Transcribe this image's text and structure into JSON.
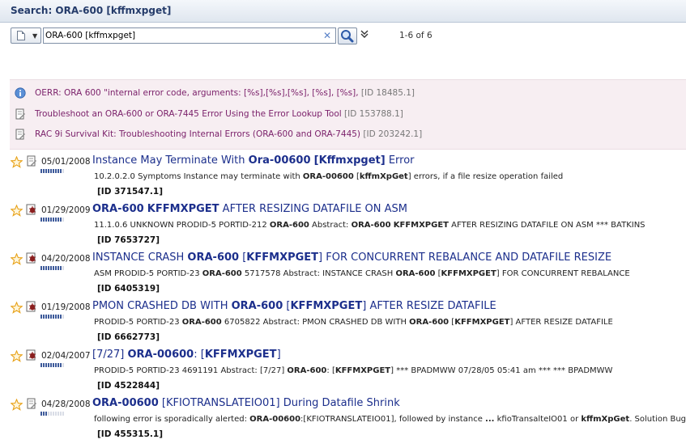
{
  "header": {
    "title": "Search: ORA-600 [kffmxpget]"
  },
  "search": {
    "query": "ORA-600 [kffmxpget]",
    "count": "1-6 of 6"
  },
  "colors": {
    "title": "#1c2f8c",
    "featured_link": "#7a1f69",
    "featured_bg": "#f7eef2",
    "star": "#e8a21a"
  },
  "featured": [
    {
      "icon": "info-icon",
      "text": "OERR:  ORA 600   \"internal error code, arguments: [%s],[%s],[%s], [%s], [%s],",
      "id": "[ID 18485.1]"
    },
    {
      "icon": "document-icon",
      "text": "Troubleshoot an ORA-600 or ORA-7445 Error Using the Error Lookup Tool",
      "id": "[ID 153788.1]"
    },
    {
      "icon": "document-icon",
      "text": "RAC 9i Survival Kit: Troubleshooting Internal Errors (ORA-600 and ORA-7445)",
      "id": "[ID 203242.1]"
    }
  ],
  "results": [
    {
      "type_icon": "note-icon",
      "date": "05/01/2008",
      "relevance": 9,
      "title": [
        {
          "t": "Instance May Terminate With "
        },
        {
          "t": "Ora-00600",
          "b": true
        },
        {
          "t": " "
        },
        {
          "t": "[Kffmxpget]",
          "b": true
        },
        {
          "t": " Error"
        }
      ],
      "snippet": [
        {
          "t": "10.2.0.2.0 Symptoms Instance may terminate with "
        },
        {
          "t": "ORA-00600",
          "b": true
        },
        {
          "t": " ["
        },
        {
          "t": "kffmXpGet",
          "b": true
        },
        {
          "t": "] errors, if a file resize operation failed"
        }
      ],
      "id": "[ID 371547.1]"
    },
    {
      "type_icon": "bug-icon",
      "date": "01/29/2009",
      "relevance": 9,
      "title": [
        {
          "t": "ORA-600",
          "b": true
        },
        {
          "t": " "
        },
        {
          "t": "KFFMXPGET",
          "b": true
        },
        {
          "t": " AFTER RESIZING DATAFILE ON ASM"
        }
      ],
      "snippet": [
        {
          "t": "11.1.0.6 UNKNOWN PRODID-5 PORTID-212 "
        },
        {
          "t": "ORA-600",
          "b": true
        },
        {
          "t": " Abstract: "
        },
        {
          "t": "ORA-600",
          "b": true
        },
        {
          "t": " "
        },
        {
          "t": "KFFMXPGET",
          "b": true
        },
        {
          "t": " AFTER RESIZING DATAFILE ON ASM *** BATKINS"
        }
      ],
      "id": "[ID 7653727]"
    },
    {
      "type_icon": "bug-icon",
      "date": "04/20/2008",
      "relevance": 9,
      "title": [
        {
          "t": "INSTANCE CRASH "
        },
        {
          "t": "ORA-600",
          "b": true
        },
        {
          "t": " ["
        },
        {
          "t": "KFFMXPGET",
          "b": true
        },
        {
          "t": "] FOR CONCURRENT REBALANCE AND DATAFILE RESIZE"
        }
      ],
      "snippet": [
        {
          "t": "ASM PRODID-5 PORTID-23 "
        },
        {
          "t": "ORA-600",
          "b": true
        },
        {
          "t": " 5717578 Abstract: INSTANCE CRASH "
        },
        {
          "t": "ORA-600",
          "b": true
        },
        {
          "t": " ["
        },
        {
          "t": "KFFMXPGET",
          "b": true
        },
        {
          "t": "] FOR CONCURRENT REBALANCE"
        }
      ],
      "id": "[ID 6405319]"
    },
    {
      "type_icon": "bug-icon",
      "date": "01/19/2008",
      "relevance": 9,
      "title": [
        {
          "t": "PMON CRASHED DB WITH "
        },
        {
          "t": "ORA-600",
          "b": true
        },
        {
          "t": " ["
        },
        {
          "t": "KFFMXPGET",
          "b": true
        },
        {
          "t": "] AFTER RESIZE DATAFILE"
        }
      ],
      "snippet": [
        {
          "t": "PRODID-5 PORTID-23 "
        },
        {
          "t": "ORA-600",
          "b": true
        },
        {
          "t": " 6705822 Abstract: PMON CRASHED DB WITH "
        },
        {
          "t": "ORA-600",
          "b": true
        },
        {
          "t": " ["
        },
        {
          "t": "KFFMXPGET",
          "b": true
        },
        {
          "t": "] AFTER RESIZE DATAFILE"
        }
      ],
      "id": "[ID 6662773]"
    },
    {
      "type_icon": "bug-icon",
      "date": "02/04/2007",
      "relevance": 9,
      "title": [
        {
          "t": "[7/27] "
        },
        {
          "t": "ORA-00600",
          "b": true
        },
        {
          "t": ":  ["
        },
        {
          "t": "KFFMXPGET",
          "b": true
        },
        {
          "t": "]"
        }
      ],
      "snippet": [
        {
          "t": "PRODID-5 PORTID-23 4691191 Abstract: [7/27] "
        },
        {
          "t": "ORA-600",
          "b": true
        },
        {
          "t": ": ["
        },
        {
          "t": "KFFMXPGET",
          "b": true
        },
        {
          "t": "] *** BPADMWW 07/28/05 05:41 am *** *** BPADMWW"
        }
      ],
      "id": "[ID 4522844]"
    },
    {
      "type_icon": "note-icon",
      "date": "04/28/2008",
      "relevance": 3,
      "title": [
        {
          "t": "ORA-00600",
          "b": true
        },
        {
          "t": " [KFIOTRANSLATEIO01] During Datafile Shrink"
        }
      ],
      "snippet": [
        {
          "t": "following error is sporadically alerted: "
        },
        {
          "t": "ORA-00600",
          "b": true
        },
        {
          "t": ":[KFIOTRANSLATEIO01], followed by instance "
        },
        {
          "t": "...",
          "b": true
        },
        {
          "t": " kfioTransalteIO01 or "
        },
        {
          "t": "kffmXpGet",
          "b": true
        },
        {
          "t": ". Solution Bug"
        }
      ],
      "id": "[ID 455315.1]"
    }
  ]
}
